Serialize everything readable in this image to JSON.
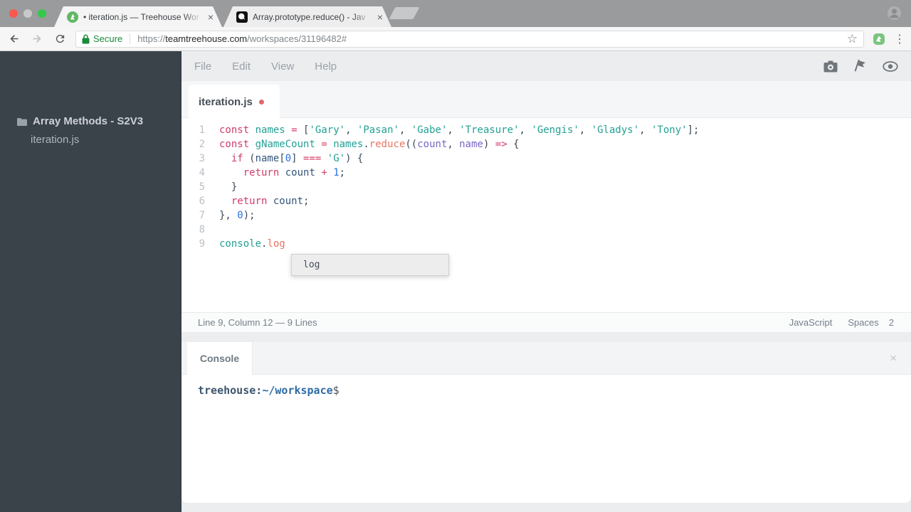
{
  "browser": {
    "tabs": [
      {
        "title": "• iteration.js — Treehouse Wor",
        "close": "×"
      },
      {
        "title": "Array.prototype.reduce() - Jav",
        "close": "×"
      }
    ],
    "toolbar": {
      "secure_label": "Secure",
      "url_scheme": "https://",
      "url_domain": "teamtreehouse.com",
      "url_path": "/workspaces/31196482#"
    },
    "kebab_glyph": "⋮",
    "star_glyph": "☆"
  },
  "sidebar": {
    "project_name": "Array Methods - S2V3",
    "file_name": "iteration.js"
  },
  "workspace": {
    "menu": [
      "File",
      "Edit",
      "View",
      "Help"
    ],
    "editor_tab_label": "iteration.js",
    "autocomplete_items": [
      "log"
    ],
    "status_bar": {
      "position": "Line 9, Column 12 — 9 Lines",
      "language": "JavaScript",
      "indent_type": "Spaces",
      "indent_size": "2"
    },
    "code_lines": [
      [
        {
          "c": "k",
          "t": "const"
        },
        {
          "c": "d",
          "t": " "
        },
        {
          "c": "v",
          "t": "names"
        },
        {
          "c": "d",
          "t": " "
        },
        {
          "c": "k",
          "t": "="
        },
        {
          "c": "d",
          "t": " ["
        },
        {
          "c": "s",
          "t": "'Gary'"
        },
        {
          "c": "d",
          "t": ", "
        },
        {
          "c": "s",
          "t": "'Pasan'"
        },
        {
          "c": "d",
          "t": ", "
        },
        {
          "c": "s",
          "t": "'Gabe'"
        },
        {
          "c": "d",
          "t": ", "
        },
        {
          "c": "s",
          "t": "'Treasure'"
        },
        {
          "c": "d",
          "t": ", "
        },
        {
          "c": "s",
          "t": "'Gengis'"
        },
        {
          "c": "d",
          "t": ", "
        },
        {
          "c": "s",
          "t": "'Gladys'"
        },
        {
          "c": "d",
          "t": ", "
        },
        {
          "c": "s",
          "t": "'Tony'"
        },
        {
          "c": "d",
          "t": "];"
        }
      ],
      [
        {
          "c": "k",
          "t": "const"
        },
        {
          "c": "d",
          "t": " "
        },
        {
          "c": "v",
          "t": "gNameCount"
        },
        {
          "c": "d",
          "t": " "
        },
        {
          "c": "k",
          "t": "="
        },
        {
          "c": "d",
          "t": " "
        },
        {
          "c": "v",
          "t": "names"
        },
        {
          "c": "d",
          "t": "."
        },
        {
          "c": "f",
          "t": "reduce"
        },
        {
          "c": "d",
          "t": "(("
        },
        {
          "c": "a",
          "t": "count"
        },
        {
          "c": "d",
          "t": ", "
        },
        {
          "c": "a",
          "t": "name"
        },
        {
          "c": "d",
          "t": ") "
        },
        {
          "c": "k",
          "t": "=>"
        },
        {
          "c": "d",
          "t": " {"
        }
      ],
      [
        {
          "c": "d",
          "t": "  "
        },
        {
          "c": "k",
          "t": "if"
        },
        {
          "c": "d",
          "t": " ("
        },
        {
          "c": "i",
          "t": "name"
        },
        {
          "c": "d",
          "t": "["
        },
        {
          "c": "n",
          "t": "0"
        },
        {
          "c": "d",
          "t": "] "
        },
        {
          "c": "k",
          "t": "==="
        },
        {
          "c": "d",
          "t": " "
        },
        {
          "c": "s",
          "t": "'G'"
        },
        {
          "c": "d",
          "t": ") {"
        }
      ],
      [
        {
          "c": "d",
          "t": "    "
        },
        {
          "c": "k",
          "t": "return"
        },
        {
          "c": "d",
          "t": " "
        },
        {
          "c": "i",
          "t": "count"
        },
        {
          "c": "d",
          "t": " "
        },
        {
          "c": "k",
          "t": "+"
        },
        {
          "c": "d",
          "t": " "
        },
        {
          "c": "n",
          "t": "1"
        },
        {
          "c": "d",
          "t": ";"
        }
      ],
      [
        {
          "c": "d",
          "t": "  }"
        }
      ],
      [
        {
          "c": "d",
          "t": "  "
        },
        {
          "c": "k",
          "t": "return"
        },
        {
          "c": "d",
          "t": " "
        },
        {
          "c": "i",
          "t": "count"
        },
        {
          "c": "d",
          "t": ";"
        }
      ],
      [
        {
          "c": "d",
          "t": "}, "
        },
        {
          "c": "n",
          "t": "0"
        },
        {
          "c": "d",
          "t": ");"
        }
      ],
      [],
      [
        {
          "c": "v",
          "t": "console"
        },
        {
          "c": "d",
          "t": "."
        },
        {
          "c": "f",
          "t": "log"
        }
      ]
    ]
  },
  "console": {
    "tab_label": "Console",
    "close": "×",
    "prompt_host": "treehouse",
    "prompt_colon": ":",
    "prompt_path": "~/workspace",
    "prompt_symbol": "$"
  },
  "colors": {
    "keyword": "#d13c68",
    "declaration_and_string": "#23a093",
    "function_call": "#e97462",
    "parameter": "#7a66c2",
    "variable_ref": "#34547b",
    "number": "#2b6fe3",
    "unsaved_dot": "#e4646c",
    "secure_green": "#1a8a3c",
    "sidebar_bg": "#3a424a",
    "window_close": "#fb5850",
    "window_minimize": "#c9c9c9",
    "window_zoom": "#34c84a"
  }
}
